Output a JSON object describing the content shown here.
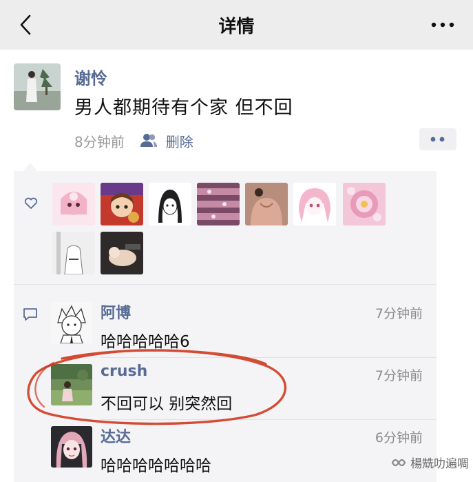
{
  "nav": {
    "title": "详情",
    "back_icon": "chevron-left-icon",
    "more_icon": "more-dots-icon"
  },
  "post": {
    "author": "谢怜",
    "text": "男人都期待有个家 但不回",
    "time": "8分钟前",
    "visibility_icon": "people-icon",
    "delete_label": "删除",
    "action_icon": "two-dots-icon"
  },
  "likes": {
    "icon": "heart-outline-icon",
    "avatars": [
      {
        "name": "like-avatar-1",
        "color": "#f4c4d6"
      },
      {
        "name": "like-avatar-2",
        "color": "#c8663a"
      },
      {
        "name": "like-avatar-3",
        "color": "#ffffff"
      },
      {
        "name": "like-avatar-4",
        "color": "#8a5a72"
      },
      {
        "name": "like-avatar-5",
        "color": "#d9a58f"
      },
      {
        "name": "like-avatar-6",
        "color": "#f6d4e0"
      },
      {
        "name": "like-avatar-7",
        "color": "#e8a8c4"
      },
      {
        "name": "like-avatar-8",
        "color": "#d8d8d8"
      },
      {
        "name": "like-avatar-9",
        "color": "#2e2a2a"
      }
    ]
  },
  "comments": {
    "icon": "comment-outline-icon",
    "items": [
      {
        "name": "阿博",
        "time": "7分钟前",
        "text": "哈哈哈哈哈6",
        "avatar_color": "#f2f2f2"
      },
      {
        "name": "crush",
        "time": "7分钟前",
        "text": "不回可以 别突然回",
        "avatar_color": "#6f8e5a"
      },
      {
        "name": "达达",
        "time": "6分钟前",
        "text": "哈哈哈哈哈哈哈",
        "avatar_color": "#e2a8b8"
      }
    ]
  },
  "watermark": {
    "text": "楊兟叻遍啁",
    "icon": "wechat-channel-icon"
  },
  "colors": {
    "nav_bg": "#ededed",
    "link_blue": "#576b95",
    "box_bg": "#f4f4f6",
    "annotation_red": "#d0381e"
  }
}
